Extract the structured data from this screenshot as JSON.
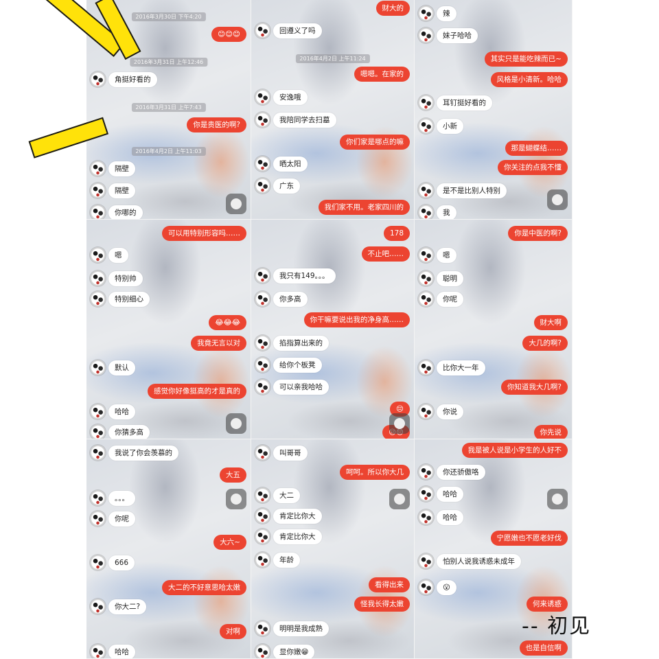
{
  "signature": "-- 初见",
  "colors": {
    "outgoing_bubble": "#ec4431",
    "incoming_bubble": "#ffffff",
    "burst": "#ffe20a"
  },
  "panels": [
    {
      "id": "p1",
      "messages": [
        {
          "kind": "ts",
          "text": "2016年3月30日 下午4:20"
        },
        {
          "kind": "out",
          "text": "😊😊😊"
        },
        {
          "kind": "ts",
          "text": "2016年3月31日 上午12:46"
        },
        {
          "kind": "in",
          "text": "角挺好看的"
        },
        {
          "kind": "ts",
          "text": "2016年3月31日 上午7:43"
        },
        {
          "kind": "out",
          "text": "你是贵医的啊?"
        },
        {
          "kind": "ts",
          "text": "2016年4月2日 上午11:03"
        },
        {
          "kind": "in",
          "text": "隔壁"
        },
        {
          "kind": "in",
          "text": "隔壁"
        },
        {
          "kind": "in",
          "text": "你哪的"
        }
      ]
    },
    {
      "id": "p2",
      "messages": [
        {
          "kind": "out",
          "text": "财大的"
        },
        {
          "kind": "in",
          "text": "回遵义了吗"
        },
        {
          "kind": "ts",
          "text": "2016年4月2日 上午11:24"
        },
        {
          "kind": "out",
          "text": "嗯嗯。在家的"
        },
        {
          "kind": "in",
          "text": "安逸哦"
        },
        {
          "kind": "in",
          "text": "我陪同学去扫墓"
        },
        {
          "kind": "out",
          "text": "你们家是哪点的嘛"
        },
        {
          "kind": "in",
          "text": "晒太阳"
        },
        {
          "kind": "in",
          "text": "广东"
        },
        {
          "kind": "out",
          "text": "我们家不用。老家四川的"
        }
      ]
    },
    {
      "id": "p3",
      "messages": [
        {
          "kind": "in",
          "text": "辣"
        },
        {
          "kind": "in",
          "text": "妹子哈哈"
        },
        {
          "kind": "out",
          "text": "其实只是能吃辣而已~"
        },
        {
          "kind": "out",
          "text": "风格是小清新。哈哈"
        },
        {
          "kind": "in",
          "text": "耳钉挺好看的"
        },
        {
          "kind": "in",
          "text": "小新"
        },
        {
          "kind": "out",
          "text": "那是蝴蝶结……"
        },
        {
          "kind": "out",
          "text": "你关注的点我不懂"
        },
        {
          "kind": "in",
          "text": "是不是比别人特别"
        },
        {
          "kind": "in",
          "text": "我"
        }
      ]
    },
    {
      "id": "p4",
      "messages": [
        {
          "kind": "out",
          "text": "可以用特别形容吗……"
        },
        {
          "kind": "in",
          "text": "嗯"
        },
        {
          "kind": "in",
          "text": "特别帅"
        },
        {
          "kind": "in",
          "text": "特别细心"
        },
        {
          "kind": "out",
          "text": "😂😂😂"
        },
        {
          "kind": "out",
          "text": "我竟无言以对"
        },
        {
          "kind": "in",
          "text": "默认"
        },
        {
          "kind": "out",
          "text": "感觉你好像挺高的才是真的"
        },
        {
          "kind": "in",
          "text": "哈哈"
        },
        {
          "kind": "in",
          "text": "你猜多高"
        }
      ]
    },
    {
      "id": "p5",
      "messages": [
        {
          "kind": "out",
          "text": "178"
        },
        {
          "kind": "out",
          "text": "不止吧……"
        },
        {
          "kind": "in",
          "text": "我只有149。。。"
        },
        {
          "kind": "in",
          "text": "你多高"
        },
        {
          "kind": "out",
          "text": "你干嘛要说出我的净身高……"
        },
        {
          "kind": "in",
          "text": "掐指算出来的"
        },
        {
          "kind": "in",
          "text": "给你个板凳"
        },
        {
          "kind": "in",
          "text": "可以亲我哈哈"
        },
        {
          "kind": "out",
          "text": "😔"
        },
        {
          "kind": "out",
          "text": "😔😔"
        }
      ]
    },
    {
      "id": "p6",
      "messages": [
        {
          "kind": "out",
          "text": "你是中医的啊?"
        },
        {
          "kind": "in",
          "text": "嗯"
        },
        {
          "kind": "in",
          "text": "聪明"
        },
        {
          "kind": "in",
          "text": "你呢"
        },
        {
          "kind": "out",
          "text": "财大啊"
        },
        {
          "kind": "out",
          "text": "大几的啊?"
        },
        {
          "kind": "in",
          "text": "比你大一年"
        },
        {
          "kind": "out",
          "text": "你知道我大几啊?"
        },
        {
          "kind": "in",
          "text": "你说"
        },
        {
          "kind": "out",
          "text": "你先说"
        }
      ]
    },
    {
      "id": "p7",
      "messages": [
        {
          "kind": "in",
          "text": "我说了你会羡慕的"
        },
        {
          "kind": "out",
          "text": "大五"
        },
        {
          "kind": "in",
          "text": "。。。"
        },
        {
          "kind": "in",
          "text": "你呢"
        },
        {
          "kind": "out",
          "text": "大六~"
        },
        {
          "kind": "in",
          "text": "666"
        },
        {
          "kind": "out",
          "text": "大二的不好意思哈太嫩"
        },
        {
          "kind": "in",
          "text": "你大二?"
        },
        {
          "kind": "out",
          "text": "对啊"
        },
        {
          "kind": "in",
          "text": "哈哈"
        }
      ]
    },
    {
      "id": "p8",
      "messages": [
        {
          "kind": "in",
          "text": "叫哥哥"
        },
        {
          "kind": "out",
          "text": "呵呵。所以你大几"
        },
        {
          "kind": "in",
          "text": "大二"
        },
        {
          "kind": "in",
          "text": "肯定比你大"
        },
        {
          "kind": "in",
          "text": "肯定比你大"
        },
        {
          "kind": "in",
          "text": "年龄"
        },
        {
          "kind": "out",
          "text": "看得出来"
        },
        {
          "kind": "out",
          "text": "怪我长得太嫩"
        },
        {
          "kind": "in",
          "text": "明明是我成熟"
        },
        {
          "kind": "in",
          "text": "显你嫩😁"
        }
      ]
    },
    {
      "id": "p9",
      "messages": [
        {
          "kind": "out",
          "text": "我是被人说是小学生的人好不"
        },
        {
          "kind": "in",
          "text": "你还骄傲咯"
        },
        {
          "kind": "in",
          "text": "哈哈"
        },
        {
          "kind": "in",
          "text": "哈哈"
        },
        {
          "kind": "out",
          "text": "宁愿嫩也不愿老好伐"
        },
        {
          "kind": "in",
          "text": "怕别人说我诱惑未成年"
        },
        {
          "kind": "in",
          "text": "😮"
        },
        {
          "kind": "out",
          "text": "何来诱惑"
        },
        {
          "kind": "out",
          "text": "也是自信啊"
        }
      ]
    }
  ]
}
